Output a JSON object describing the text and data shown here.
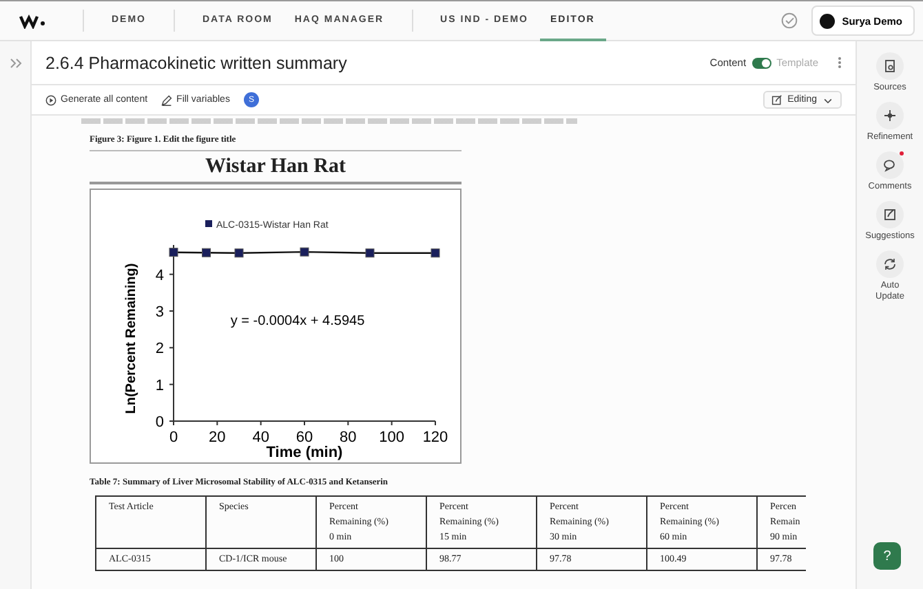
{
  "nav": {
    "groups": [
      [
        {
          "label": "DEMO",
          "selected": false
        }
      ],
      [
        {
          "label": "DATA ROOM",
          "selected": false
        },
        {
          "label": "HAQ MANAGER",
          "selected": false
        }
      ],
      [
        {
          "label": "US IND - DEMO",
          "selected": false
        },
        {
          "label": "EDITOR",
          "selected": true
        }
      ]
    ],
    "user": {
      "name": "Surya Demo"
    }
  },
  "editor": {
    "title": "2.6.4 Pharmacokinetic written summary",
    "mode_toggle": {
      "left_label": "Content",
      "right_label": "Template",
      "on": true
    },
    "toolbar": {
      "generate": "Generate all content",
      "fill": "Fill variables",
      "badge": "S",
      "mode": "Editing"
    }
  },
  "document": {
    "figure_caption": "Figure 3:  Figure 1. Edit the figure title",
    "figure_heading": "Wistar Han Rat",
    "chart_data": {
      "type": "line",
      "xlabel": "Time (min)",
      "ylabel": "Ln(Percent Remaining)",
      "x": [
        0,
        15,
        30,
        60,
        90,
        120
      ],
      "series": [
        {
          "name": "ALC-0315-Wistar Han Rat",
          "color": "#1a1f5c",
          "marker": "square",
          "values": [
            4.6,
            4.59,
            4.58,
            4.61,
            4.58,
            4.58
          ]
        }
      ],
      "xlim": [
        0,
        120
      ],
      "ylim": [
        0,
        4.8
      ],
      "xticks": [
        0,
        20,
        40,
        60,
        80,
        100,
        120
      ],
      "yticks": [
        0,
        1,
        2,
        3,
        4
      ],
      "annotations": [
        "y = -0.0004x + 4.5945"
      ]
    },
    "table_caption": "Table 7:  Summary of Liver Microsomal Stability of ALC-0315 and Ketanserin",
    "table": {
      "columns": [
        "Test Article",
        "Species",
        "Percent\nRemaining (%)\n0 min",
        "Percent\nRemaining (%)\n15 min",
        "Percent\nRemaining (%)\n30 min",
        "Percent\nRemaining (%)\n60 min",
        "Percen\nRemain\n90 min"
      ],
      "rows": [
        [
          "ALC-0315",
          "CD-1/ICR mouse",
          "100",
          "98.77",
          "97.78",
          "100.49",
          "97.78"
        ]
      ]
    }
  },
  "rail": [
    {
      "label": "Sources",
      "kind": "sources",
      "unread": false
    },
    {
      "label": "Refinement",
      "kind": "refine",
      "unread": false
    },
    {
      "label": "Comments",
      "kind": "comments",
      "unread": true
    },
    {
      "label": "Suggestions",
      "kind": "suggest",
      "unread": false
    },
    {
      "label": "Auto Update",
      "kind": "update",
      "unread": false
    }
  ],
  "help": {
    "label": "?"
  }
}
